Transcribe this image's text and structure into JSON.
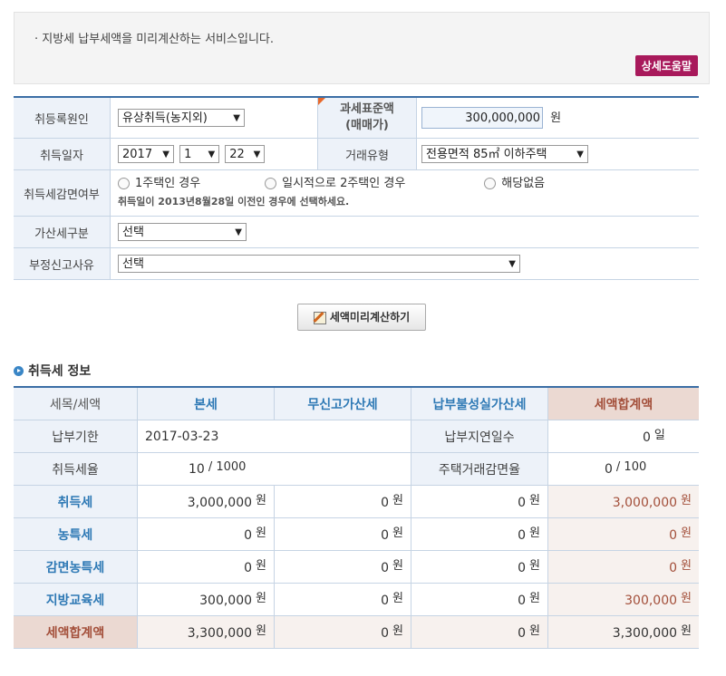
{
  "notice": {
    "text": "· 지방세 납부세액을 미리계산하는 서비스입니다.",
    "help_button": "상세도움말"
  },
  "form": {
    "reason_label": "취등록원인",
    "reason_value": "유상취득(농지외)",
    "tax_base_label_1": "과세표준액",
    "tax_base_label_2": "(매매가)",
    "tax_base_value": "300,000,000",
    "tax_base_unit": "원",
    "date_label": "취득일자",
    "year": "2017",
    "month": "1",
    "day": "22",
    "trade_type_label": "거래유형",
    "trade_type_value": "전용면적 85㎡ 이하주택",
    "reduction_label": "취득세감면여부",
    "reduction_options": [
      "1주택인 경우",
      "일시적으로 2주택인 경우",
      "해당없음"
    ],
    "reduction_note": "취득일이 2013년8월28일 이전인 경우에 선택하세요.",
    "penalty_label": "가산세구분",
    "penalty_value": "선택",
    "improper_label": "부정신고사유",
    "improper_value": "선택"
  },
  "calc_button": "세액미리계산하기",
  "section_title": "취득세 정보",
  "info": {
    "headers": [
      "세목/세액",
      "본세",
      "무신고가산세",
      "납부불성실가산세",
      "세액합계액"
    ],
    "due_label": "납부기한",
    "due_value": "2017-03-23",
    "late_days_label": "납부지연일수",
    "late_days_value": "0",
    "late_days_unit": "일",
    "rate_label": "취득세율",
    "rate_value": "10",
    "rate_unit": "/ 1000",
    "house_reduction_label": "주택거래감면율",
    "house_reduction_value": "0",
    "house_reduction_unit": "/ 100",
    "won": "원",
    "rows": [
      {
        "label": "취득세",
        "base": "3,000,000",
        "no_report": "0",
        "late": "0",
        "total": "3,000,000"
      },
      {
        "label": "농특세",
        "base": "0",
        "no_report": "0",
        "late": "0",
        "total": "0"
      },
      {
        "label": "감면농특세",
        "base": "0",
        "no_report": "0",
        "late": "0",
        "total": "0"
      },
      {
        "label": "지방교육세",
        "base": "300,000",
        "no_report": "0",
        "late": "0",
        "total": "300,000"
      },
      {
        "label": "세액합계액",
        "base": "3,300,000",
        "no_report": "0",
        "late": "0",
        "total": "3,300,000"
      }
    ]
  }
}
